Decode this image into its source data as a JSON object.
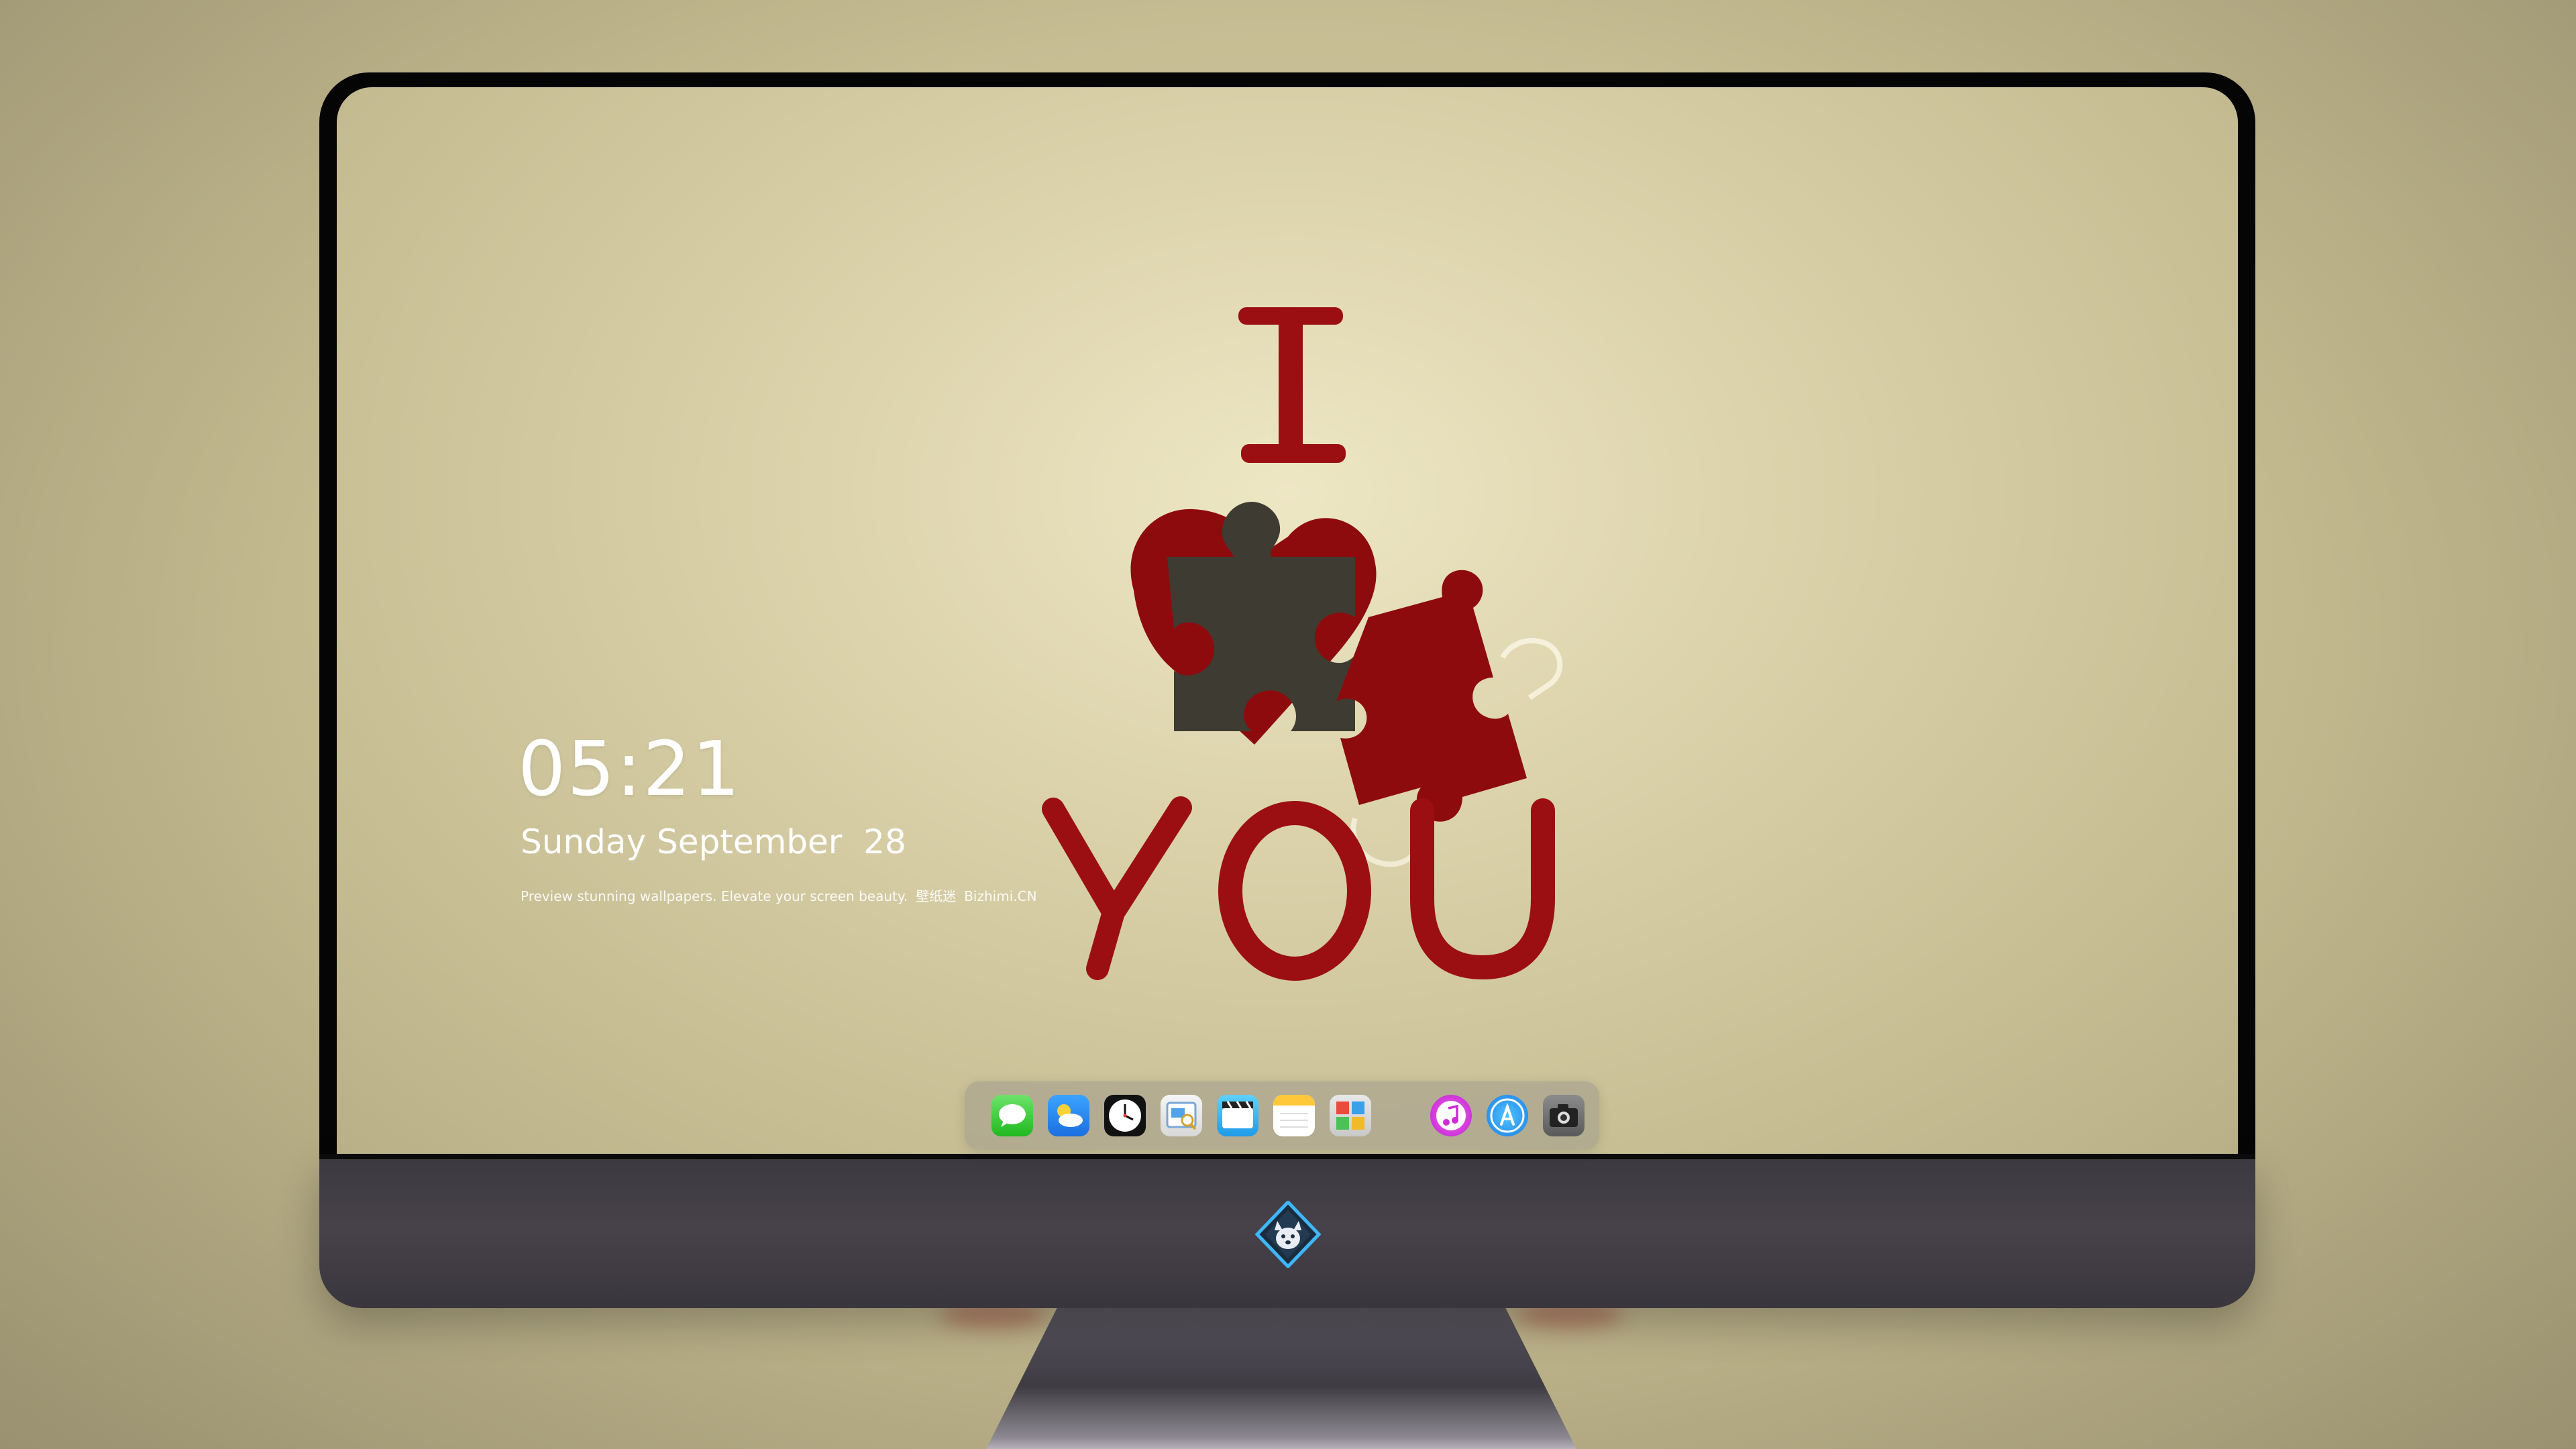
{
  "lockscreen": {
    "time": "05:21",
    "date": "Sunday September  28",
    "tagline_left": "Preview stunning wallpapers. Elevate your screen beauty.",
    "tagline_brand_cn": "壁纸迷",
    "tagline_brand": "Bizhimi.CN"
  },
  "wallpaper": {
    "word_top": "I",
    "word_bottom": "YOU",
    "colors": {
      "text": "#9b0f12",
      "piece_dark": "#3e3b33",
      "piece_red": "#8e0b0d",
      "background": "#e8e0bd"
    }
  },
  "dock": {
    "apps": [
      {
        "name": "messages-icon"
      },
      {
        "name": "weather-icon"
      },
      {
        "name": "clock-icon"
      },
      {
        "name": "preview-icon"
      },
      {
        "name": "clips-icon"
      },
      {
        "name": "notes-icon"
      },
      {
        "name": "photo-booth-icon"
      },
      {
        "name": "itunes-icon"
      },
      {
        "name": "app-store-icon"
      },
      {
        "name": "camera-icon"
      }
    ]
  },
  "monitor": {
    "logo_icon": "wolf-mascot-icon"
  }
}
